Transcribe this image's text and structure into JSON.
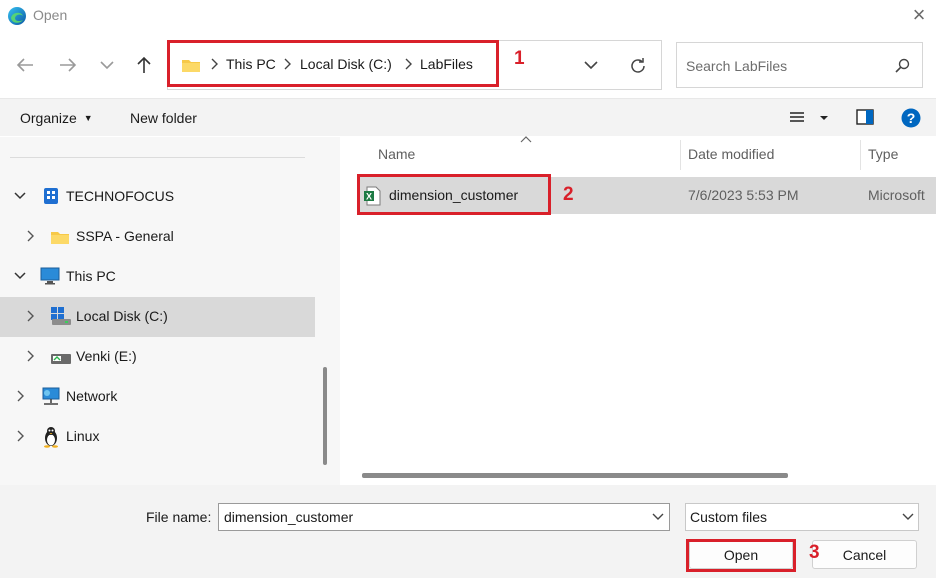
{
  "window": {
    "title": "Open",
    "close_glyph": "×"
  },
  "nav": {
    "back": "back-arrow-icon",
    "forward": "forward-arrow-icon",
    "recent": "chevron-down-icon",
    "up": "up-arrow-icon"
  },
  "breadcrumb": {
    "items": [
      "This PC",
      "Local Disk (C:)",
      "LabFiles"
    ]
  },
  "search": {
    "placeholder": "Search LabFiles"
  },
  "commands": {
    "organize": "Organize",
    "new_folder": "New folder"
  },
  "tree": {
    "items": [
      {
        "label": "TECHNOFOCUS",
        "icon": "building-icon"
      },
      {
        "label": "SSPA - General",
        "icon": "folder-icon"
      },
      {
        "label": "This PC",
        "icon": "monitor-icon"
      },
      {
        "label": "Local Disk (C:)",
        "icon": "disk-icon"
      },
      {
        "label": "Venki (E:)",
        "icon": "drive-icon"
      },
      {
        "label": "Network",
        "icon": "network-icon"
      },
      {
        "label": "Linux",
        "icon": "penguin-icon"
      }
    ]
  },
  "columns": {
    "name": "Name",
    "date": "Date modified",
    "type": "Type"
  },
  "files": [
    {
      "name": "dimension_customer",
      "date": "7/6/2023 5:53 PM",
      "type": "Microsoft"
    }
  ],
  "footer": {
    "file_name_label": "File name:",
    "file_name_value": "dimension_customer",
    "filter_value": "Custom files",
    "open_label": "Open",
    "cancel_label": "Cancel"
  },
  "annotations": {
    "one": "1",
    "two": "2",
    "three": "3"
  },
  "colors": {
    "highlight": "#d9202a",
    "selected": "#d9d9d9",
    "accent": "#0067c0"
  }
}
